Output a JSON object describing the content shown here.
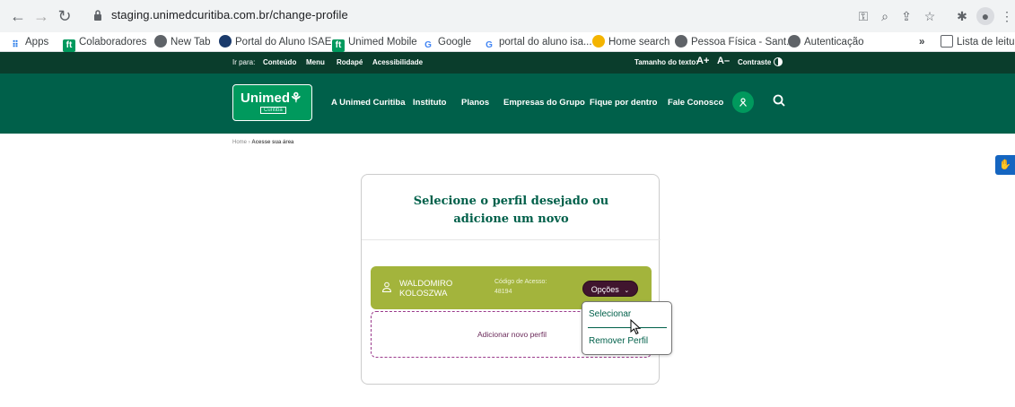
{
  "browser": {
    "url": "staging.unimedcuritiba.com.br/change-profile",
    "bookmarks": [
      {
        "label": "Apps",
        "icon": "apps-grid-icon"
      },
      {
        "label": "Colaboradores",
        "icon": "unimed-icon"
      },
      {
        "label": "New Tab",
        "icon": "globe-icon"
      },
      {
        "label": "Portal do Aluno ISAE",
        "icon": "isae-icon"
      },
      {
        "label": "Unimed Mobile",
        "icon": "unimed-icon"
      },
      {
        "label": "Google",
        "icon": "google-icon"
      },
      {
        "label": "portal do aluno isa...",
        "icon": "google-icon"
      },
      {
        "label": "Home search",
        "icon": "home-search-icon"
      },
      {
        "label": "Pessoa Física - Sant...",
        "icon": "globe-icon"
      },
      {
        "label": "Autenticação",
        "icon": "globe-icon"
      }
    ],
    "more_label": "»",
    "reading_list": "Lista de leitura"
  },
  "topbar": {
    "goto_label": "Ir para:",
    "links": [
      "Conteúdo",
      "Menu",
      "Rodapé",
      "Acessibilidade"
    ],
    "text_size_label": "Tamanho do texto:",
    "increase": "A+",
    "decrease": "A–",
    "contrast": "Contraste"
  },
  "header": {
    "logo_text": "Unimed",
    "logo_sub": "Curitiba",
    "nav": [
      "A Unimed Curitiba",
      "Instituto",
      "Planos",
      "Empresas do Grupo",
      "Fique por dentro",
      "Fale Conosco"
    ]
  },
  "breadcrumb": {
    "home": "Home",
    "separator": "›",
    "current": "Acesse sua área"
  },
  "card": {
    "title_line1": "Selecione o perfil desejado ou",
    "title_line2": "adicione um novo",
    "profile": {
      "name_line1": "WALDOMIRO",
      "name_line2": "KOLOSZWA",
      "code_label": "Código de Acesso:",
      "code_value": "48194",
      "options_label": "Opções"
    },
    "add_label": "Adicionar novo perfil"
  },
  "dropdown": {
    "select": "Selecionar",
    "remove": "Remover Perfil"
  },
  "colors": {
    "brand_dark": "#0a3d2c",
    "brand": "#00604a",
    "profile_bg": "#a3b43c",
    "options_bg": "#40152e"
  }
}
